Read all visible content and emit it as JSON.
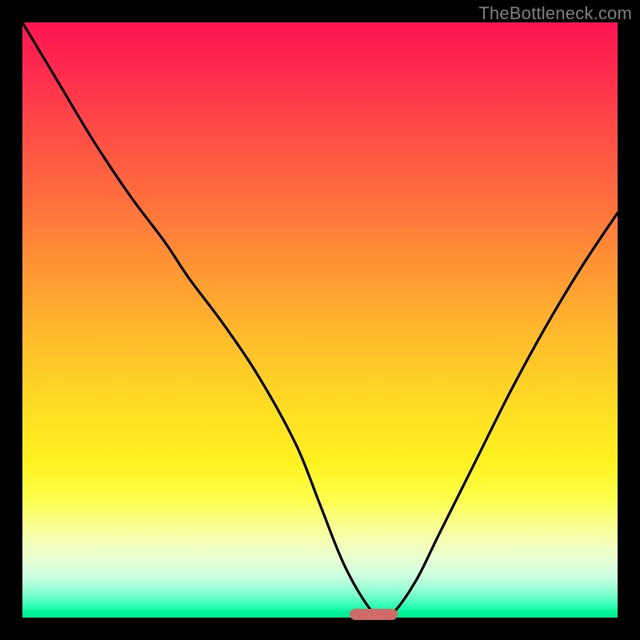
{
  "watermark": "TheBottleneck.com",
  "chart_data": {
    "type": "line",
    "title": "",
    "xlabel": "",
    "ylabel": "",
    "xlim": [
      0,
      100
    ],
    "ylim": [
      0,
      100
    ],
    "x": [
      0,
      6,
      12,
      18,
      24,
      28,
      34,
      40,
      46,
      50,
      54,
      58,
      60,
      62,
      66,
      70,
      76,
      82,
      88,
      94,
      100
    ],
    "values": [
      100,
      90,
      80,
      71,
      63,
      57,
      49,
      40,
      29,
      19,
      9,
      2,
      0.5,
      0.5,
      6,
      14,
      26,
      38,
      49,
      59,
      68
    ],
    "annotations": [
      {
        "label": "bottleneck-marker",
        "x_start": 55,
        "x_end": 63,
        "y": 0.5
      }
    ],
    "grid": false,
    "legend": false
  },
  "colors": {
    "frame": "#000000",
    "curve": "#000000",
    "marker": "#cf6a67",
    "watermark": "#808080",
    "gradient_top": "#ff1552",
    "gradient_bottom": "#00e98f"
  }
}
